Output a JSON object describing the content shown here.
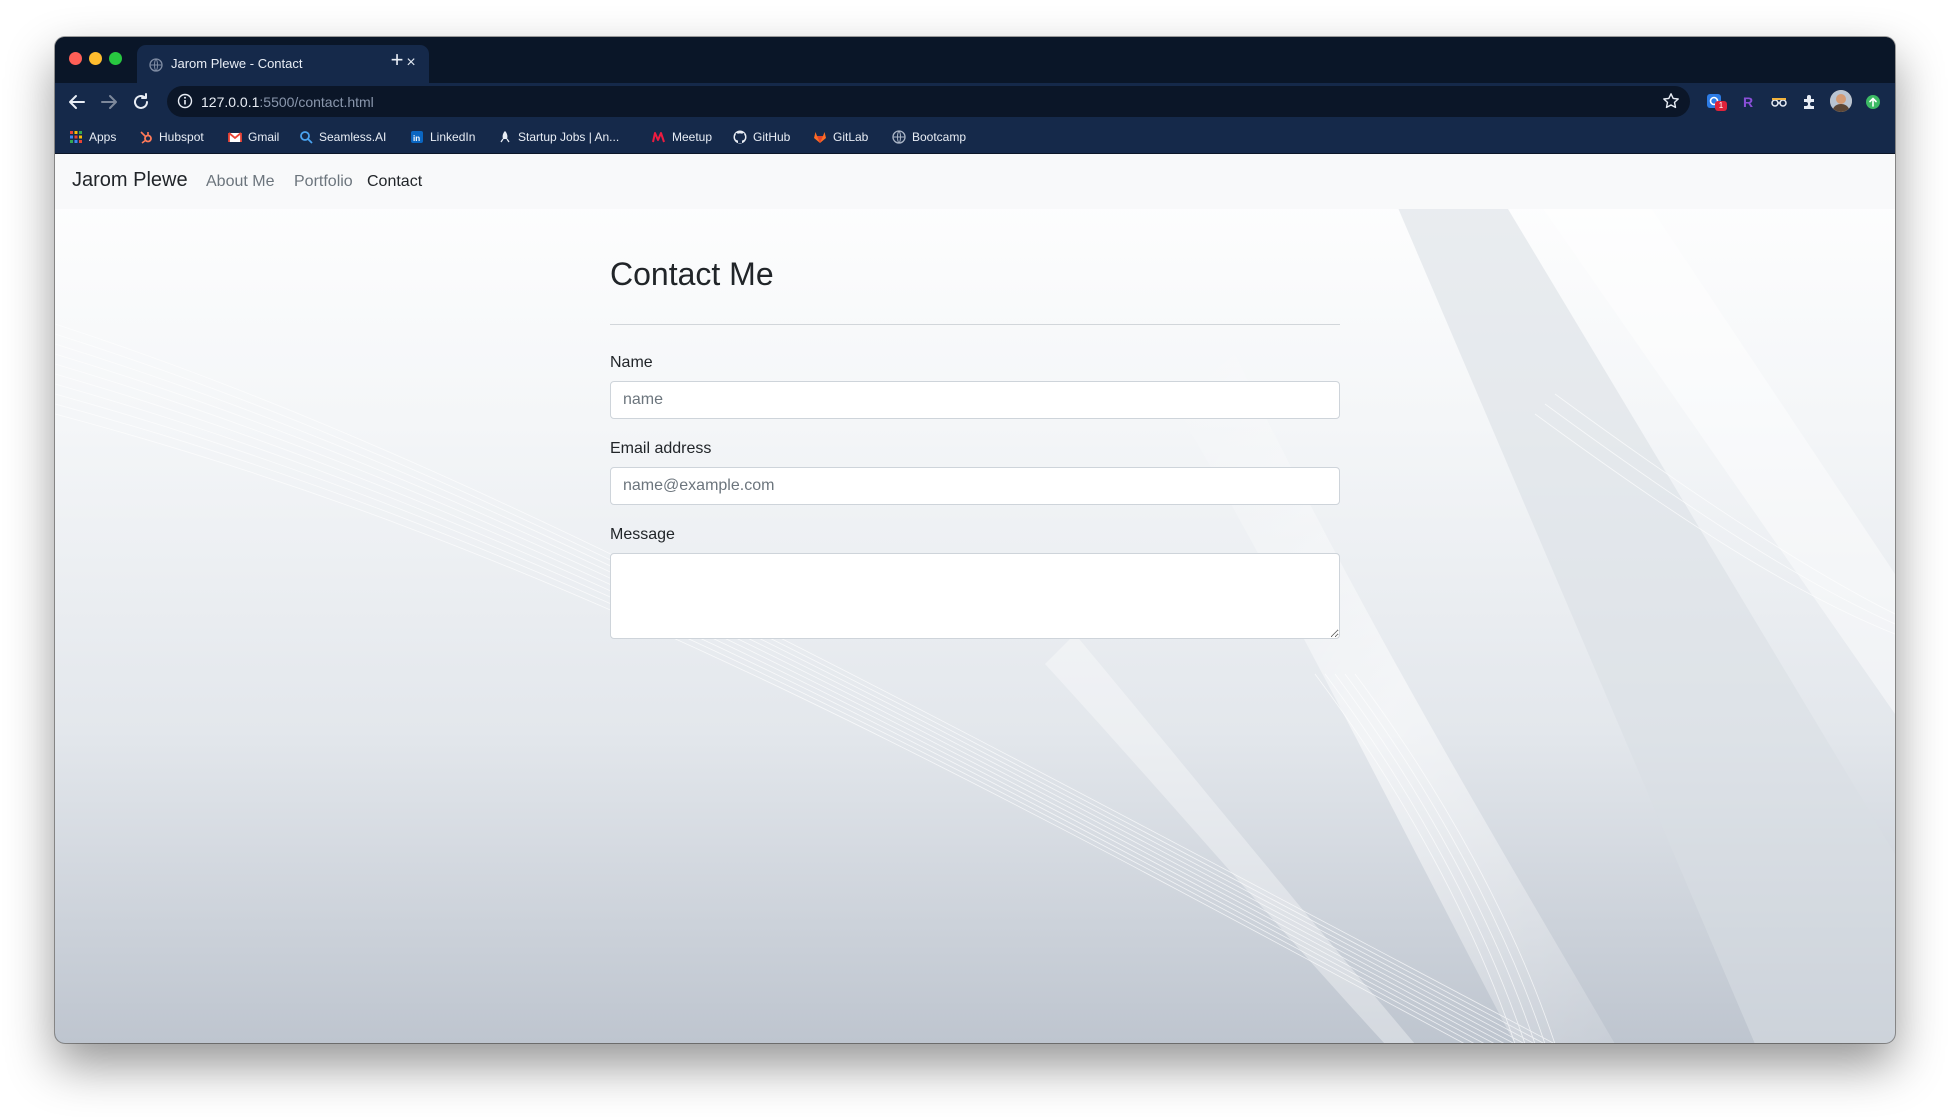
{
  "browser": {
    "tab_title": "Jarom Plewe - Contact",
    "tab_close": "×",
    "new_tab": "+",
    "url_host": "127.0.0.1",
    "url_path": ":5500/contact.html",
    "extension_badge": "1",
    "bookmarks": [
      {
        "label": "Apps",
        "icon": "apps-grid-icon"
      },
      {
        "label": "Hubspot",
        "icon": "hubspot-icon"
      },
      {
        "label": "Gmail",
        "icon": "gmail-icon"
      },
      {
        "label": "Seamless.AI",
        "icon": "seamless-icon"
      },
      {
        "label": "LinkedIn",
        "icon": "linkedin-icon"
      },
      {
        "label": "Startup Jobs | An...",
        "icon": "startup-jobs-icon"
      },
      {
        "label": "Meetup",
        "icon": "meetup-icon"
      },
      {
        "label": "GitHub",
        "icon": "github-icon"
      },
      {
        "label": "GitLab",
        "icon": "gitlab-icon"
      },
      {
        "label": "Bootcamp",
        "icon": "globe-icon"
      }
    ]
  },
  "navbar": {
    "brand": "Jarom Plewe",
    "links": [
      "About Me",
      "Portfolio",
      "Contact"
    ],
    "active": "Contact"
  },
  "contact": {
    "heading": "Contact Me",
    "name_label": "Name",
    "name_placeholder": "name",
    "email_label": "Email address",
    "email_placeholder": "name@example.com",
    "message_label": "Message",
    "message_value": ""
  },
  "colors": {
    "browser_frame": "#0a1628",
    "browser_toolbar": "#15294a",
    "navbar_bg": "#f8f9fa",
    "text": "#212529",
    "muted_link": "#6c757d",
    "input_border": "#ced4da"
  }
}
